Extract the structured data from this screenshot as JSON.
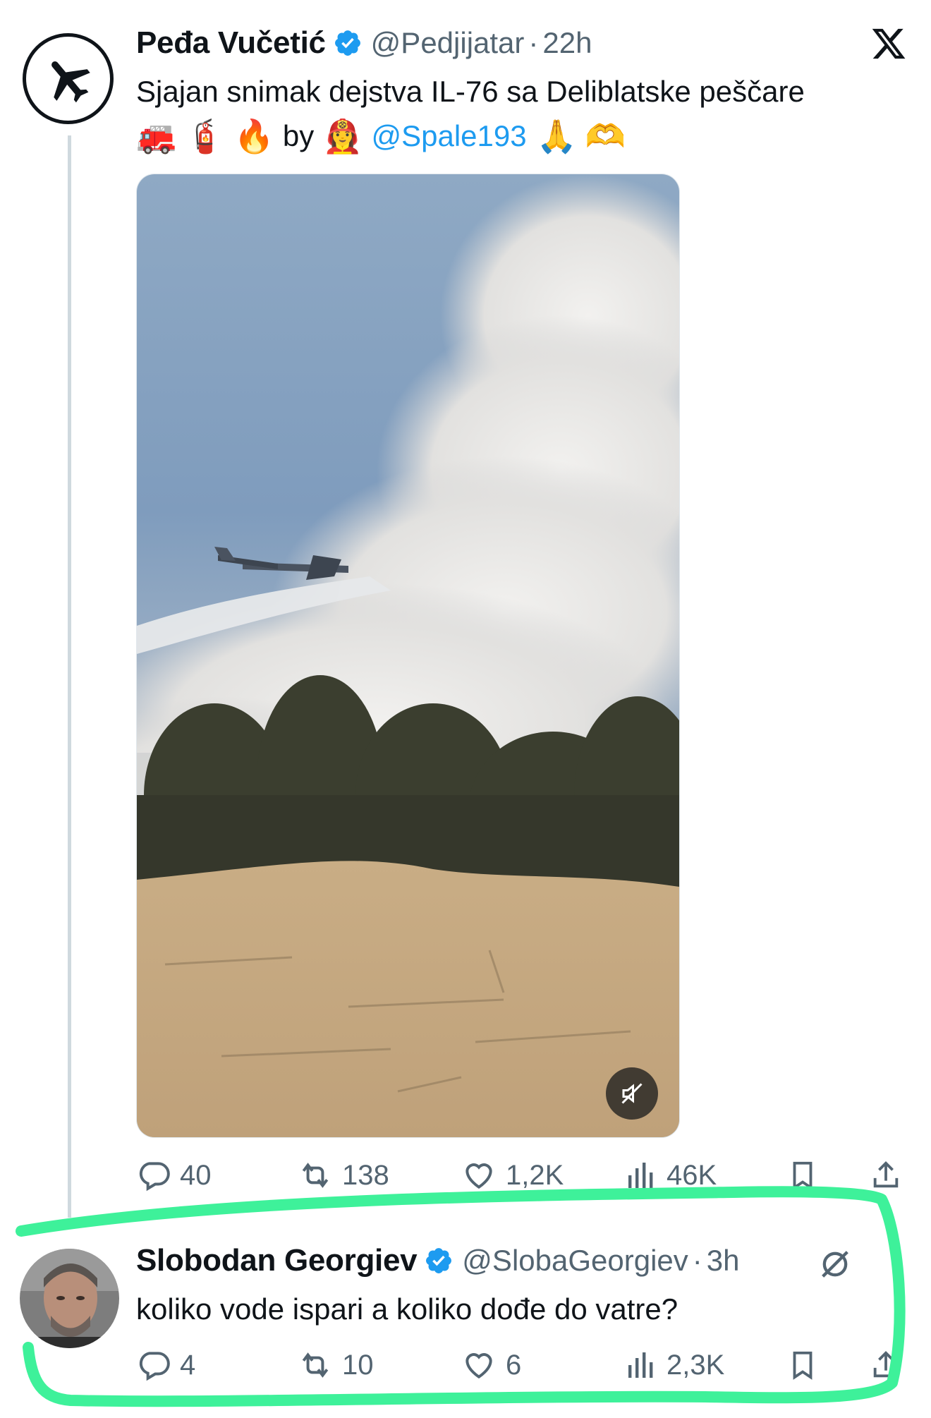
{
  "tweet1": {
    "author_name": "Peđa Vučetić",
    "handle": "@Pedjijatar",
    "separator": "·",
    "time": "22h",
    "avatar_icon": "airplane-icon",
    "text": "Sjajan snimak dejstva IL-76 sa Deliblatske peščare",
    "emoji_line": {
      "emojis_before": [
        "🚒",
        "🧯",
        "🔥"
      ],
      "by_text": "by",
      "person_emoji": "👩‍🚒",
      "mention": "@Spale193",
      "emojis_after": [
        "🙏",
        "🫶"
      ]
    },
    "media_kind": "video",
    "mute_icon": "speaker-muted-icon",
    "stats": {
      "replies": "40",
      "reposts": "138",
      "likes": "1,2K",
      "views": "46K"
    }
  },
  "tweet2": {
    "author_name": "Slobodan Georgiev",
    "handle": "@SlobaGeorgiev",
    "separator": "·",
    "time": "3h",
    "text": "koliko vode ispari a koliko dođe do vatre?",
    "stats": {
      "replies": "4",
      "reposts": "10",
      "likes": "6",
      "views": "2,3K"
    }
  },
  "colors": {
    "text": "#0f1419",
    "secondary": "#536471",
    "link": "#1d9bf0",
    "verified": "#1d9bf0",
    "highlight": "#3ef19a",
    "thread_line": "#cfd9de"
  }
}
